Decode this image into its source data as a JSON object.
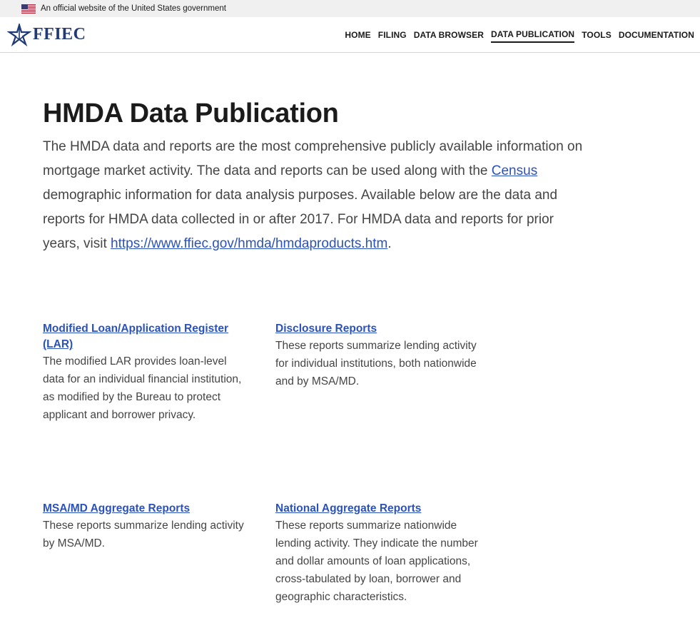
{
  "banner": {
    "text": "An official website of the United States government",
    "flag_icon": "us-flag-icon"
  },
  "header": {
    "logo_text": "FFIEC",
    "nav": [
      {
        "label": "HOME",
        "active": false
      },
      {
        "label": "FILING",
        "active": false
      },
      {
        "label": "DATA BROWSER",
        "active": false
      },
      {
        "label": "DATA PUBLICATION",
        "active": true
      },
      {
        "label": "TOOLS",
        "active": false
      },
      {
        "label": "DOCUMENTATION",
        "active": false
      }
    ]
  },
  "main": {
    "title": "HMDA Data Publication",
    "intro": {
      "part1": "The HMDA data and reports are the most comprehensive publicly available information on mortgage market activity. The data and reports can be used along with the ",
      "census_link": "Census",
      "part2": " demographic information for data analysis purposes. Available below are the data and reports for HMDA data collected in or after 2017. For HMDA data and reports for prior years, visit ",
      "url_link": "https://www.ffiec.gov/hmda/hmdaproducts.htm",
      "part3": "."
    },
    "cards": [
      {
        "title": "Modified Loan/Application Register (LAR)",
        "description": "The modified LAR provides loan-level data for an individual financial institution, as modified by the Bureau to protect applicant and borrower privacy."
      },
      {
        "title": "Disclosure Reports",
        "description": "These reports summarize lending activity for individual institutions, both nationwide and by MSA/MD."
      },
      {
        "title": "MSA/MD Aggregate Reports",
        "description": "These reports summarize lending activity by MSA/MD."
      },
      {
        "title": "National Aggregate Reports",
        "description": "These reports summarize nationwide lending activity. They indicate the number and dollar amounts of loan applications, cross-tabulated by loan, borrower and geographic characteristics."
      }
    ]
  },
  "colors": {
    "link": "#2a52be",
    "brand": "#1f3a75",
    "banner_bg": "#f0f0f0"
  }
}
